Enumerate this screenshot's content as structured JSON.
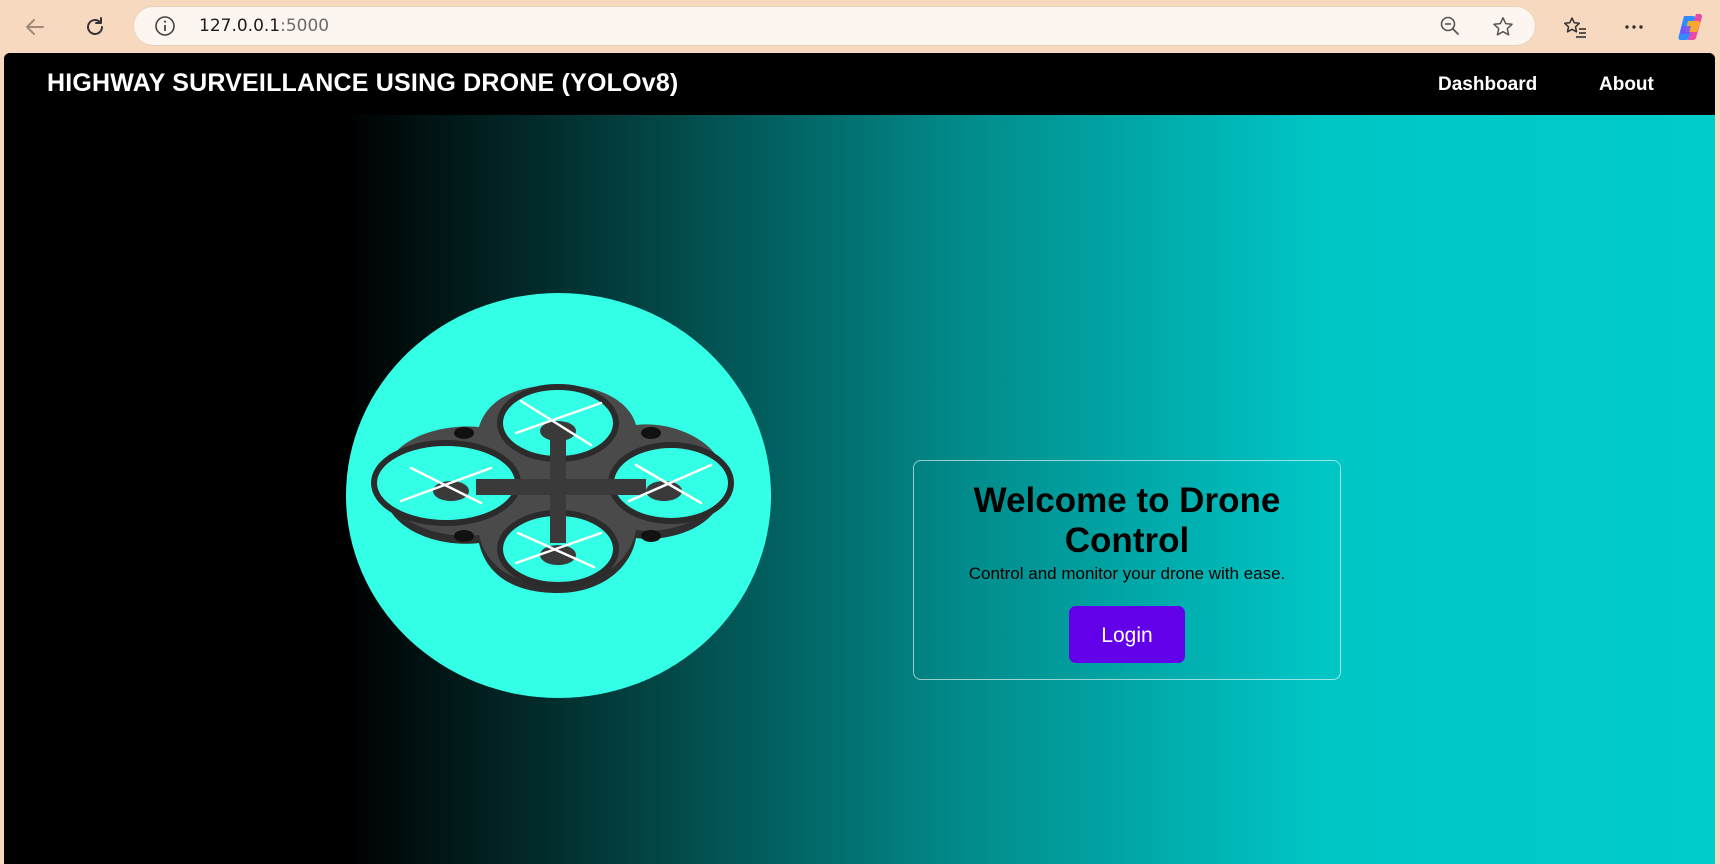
{
  "browser": {
    "url_host": "127.0.0.1",
    "url_port": ":5000",
    "icons": [
      "back-arrow-icon",
      "refresh-icon",
      "info-icon",
      "zoom-out-icon",
      "favorite-star-icon",
      "favorites-list-icon",
      "more-options-icon",
      "copilot-icon"
    ]
  },
  "header": {
    "title": "HIGHWAY SURVEILLANCE USING DRONE (YOLOv8)",
    "nav": [
      {
        "label": "Dashboard"
      },
      {
        "label": "About"
      }
    ]
  },
  "hero": {
    "illustration": "drone-icon",
    "colors": {
      "circle": "#33ffe6",
      "gradient_start": "#000000",
      "gradient_end": "#00cccc"
    }
  },
  "welcome": {
    "title": "Welcome to Drone Control",
    "subtitle": "Control and monitor your drone with ease.",
    "login_label": "Login",
    "login_color": "#6200ea"
  }
}
